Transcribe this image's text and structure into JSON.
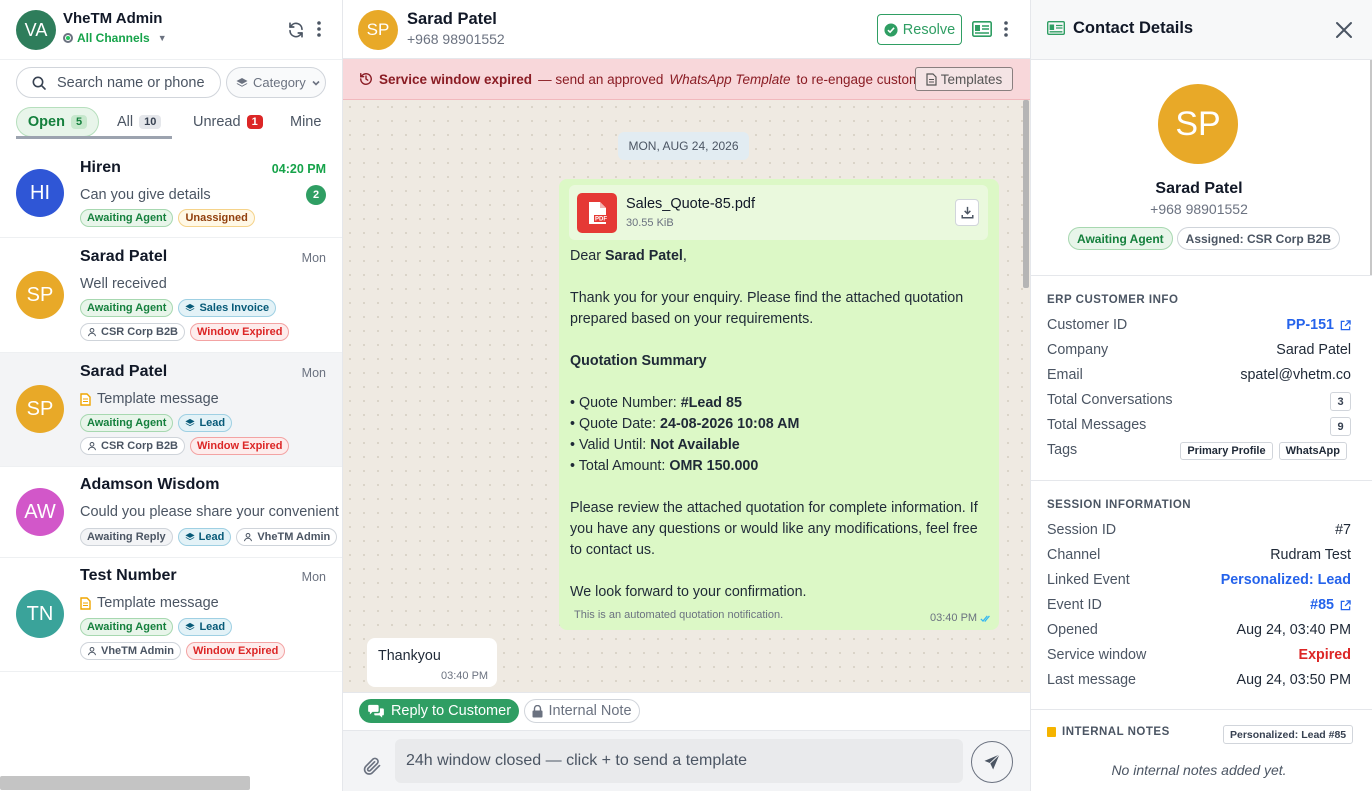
{
  "colors": {
    "brand_green": "#2f9e63",
    "avatar_gold": "#e8a928",
    "banner_bg": "#f8d7da",
    "link_blue": "#2563eb",
    "expired_red": "#dc2626"
  },
  "sidebar": {
    "user_initials": "VA",
    "user_name": "VheTM Admin",
    "channel_label": "All Channels",
    "search_placeholder": "Search name or phone",
    "category_label": "Category",
    "tabs": [
      {
        "label": "Open",
        "count": "5"
      },
      {
        "label": "All",
        "count": "10"
      },
      {
        "label": "Unread",
        "count": "1"
      },
      {
        "label": "Mine",
        "count": ""
      }
    ],
    "conversations": [
      {
        "initials": "HI",
        "name": "Hiren",
        "time": "04:20 PM",
        "preview": "Can you give details",
        "unread": "2",
        "chips": [
          "Awaiting Agent",
          "Unassigned"
        ]
      },
      {
        "initials": "SP",
        "name": "Sarad Patel",
        "time": "Mon",
        "preview": "Well received",
        "chips": [
          "Awaiting Agent",
          "Sales Invoice",
          "CSR Corp B2B",
          "Window Expired"
        ]
      },
      {
        "initials": "SP",
        "name": "Sarad Patel",
        "time": "Mon",
        "preview": "Template message",
        "chips": [
          "Awaiting Agent",
          "Lead",
          "CSR Corp B2B",
          "Window Expired"
        ]
      },
      {
        "initials": "AW",
        "name": "Adamson Wisdom",
        "time": "",
        "preview": "Could you please share your convenient ti",
        "chips": [
          "Awaiting Reply",
          "Lead",
          "VheTM Admin"
        ]
      },
      {
        "initials": "TN",
        "name": "Test Number",
        "time": "Mon",
        "preview": "Template message",
        "chips": [
          "Awaiting Agent",
          "Lead",
          "VheTM Admin",
          "Window Expired"
        ]
      }
    ]
  },
  "chat": {
    "contact_initials": "SP",
    "contact_name": "Sarad Patel",
    "contact_phone": "+968 98901552",
    "resolve_label": "Resolve",
    "banner": {
      "strong": "Service window expired",
      "pre": "— send an approved",
      "italic": "WhatsApp Template",
      "post": "to re-engage customer.",
      "button": "Templates"
    },
    "date_separator": "MON, AUG 24, 2026",
    "outgoing": {
      "file_name": "Sales_Quote-85.pdf",
      "file_size": "30.55 KiB",
      "pdf_label": "PDF",
      "dear": "Dear",
      "dear_name": "Sarad Patel",
      "intro1": "Thank you for your enquiry. Please find the attached quotation",
      "intro2": "prepared based on your requirements.",
      "summary_title": "Quotation Summary",
      "lines": [
        {
          "label": "• Quote Number: ",
          "value": "#Lead 85"
        },
        {
          "label": "• Quote Date: ",
          "value": "24-08-2026 10:08 AM"
        },
        {
          "label": "• Valid Until: ",
          "value": "Not Available"
        },
        {
          "label": "• Total Amount: ",
          "value": "OMR 150.000"
        }
      ],
      "review1": "Please review the attached quotation for complete information. If",
      "review2": "you have any questions or would like any modifications, feel free",
      "review3": "to contact us.",
      "closing": "We look forward to your confirmation.",
      "footer": "This is an automated quotation notification.",
      "time": "03:40 PM"
    },
    "incoming": {
      "text": "Thankyou",
      "time": "03:40 PM"
    },
    "mode_reply": "Reply to Customer",
    "mode_note": "Internal Note",
    "composer_placeholder": "24h window closed — click + to send a template"
  },
  "contact": {
    "title": "Contact Details",
    "initials": "SP",
    "name": "Sarad Patel",
    "phone": "+968 98901552",
    "status_chip": "Awaiting Agent",
    "assigned_chip": "Assigned: CSR Corp B2B",
    "erp": {
      "title": "ERP CUSTOMER INFO",
      "customer_id_label": "Customer ID",
      "customer_id": "PP-151",
      "company_label": "Company",
      "company": "Sarad Patel",
      "email_label": "Email",
      "email": "spatel@vhetm.co",
      "conv_label": "Total Conversations",
      "conv": "3",
      "msgs_label": "Total Messages",
      "msgs": "9",
      "tags_label": "Tags",
      "tags": [
        "Primary Profile",
        "WhatsApp"
      ]
    },
    "session": {
      "title": "SESSION INFORMATION",
      "session_id_label": "Session ID",
      "session_id": "#7",
      "channel_label": "Channel",
      "channel": "Rudram Test",
      "linked_label": "Linked Event",
      "linked": "Personalized: Lead",
      "event_label": "Event ID",
      "event": "#85",
      "opened_label": "Opened",
      "opened": "Aug 24, 03:40 PM",
      "window_label": "Service window",
      "window": "Expired",
      "last_label": "Last message",
      "last": "Aug 24, 03:50 PM"
    },
    "notes": {
      "title": "INTERNAL NOTES",
      "chip": "Personalized: Lead #85",
      "empty": "No internal notes added yet."
    }
  }
}
